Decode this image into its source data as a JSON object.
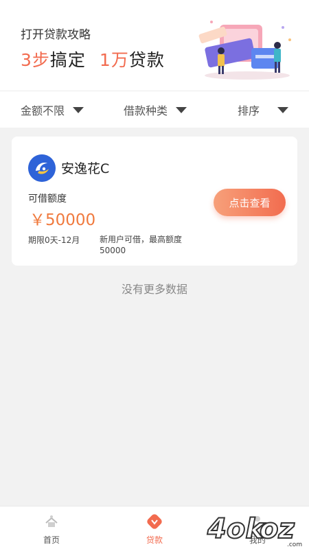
{
  "banner": {
    "subtitle": "打开贷款攻略",
    "headline_part1_num": "3步",
    "headline_part1_text": "搞定",
    "headline_part2_num": "1万",
    "headline_part2_text": "贷款"
  },
  "filters": {
    "amount": "金额不限",
    "type": "借款种类",
    "sort": "排序"
  },
  "product": {
    "name": "安逸花C",
    "amount_label": "可借额度",
    "amount": "￥50000",
    "cta": "点击查看",
    "term": "期限0天-12月",
    "note": "新用户可借，最高额度50000"
  },
  "list_end": "没有更多数据",
  "tabbar": {
    "home": "首页",
    "loan": "贷款",
    "mine": "我的"
  },
  "colors": {
    "accent": "#f26b4f",
    "amount": "#f07a3e",
    "logo_blue": "#2e63d8"
  }
}
